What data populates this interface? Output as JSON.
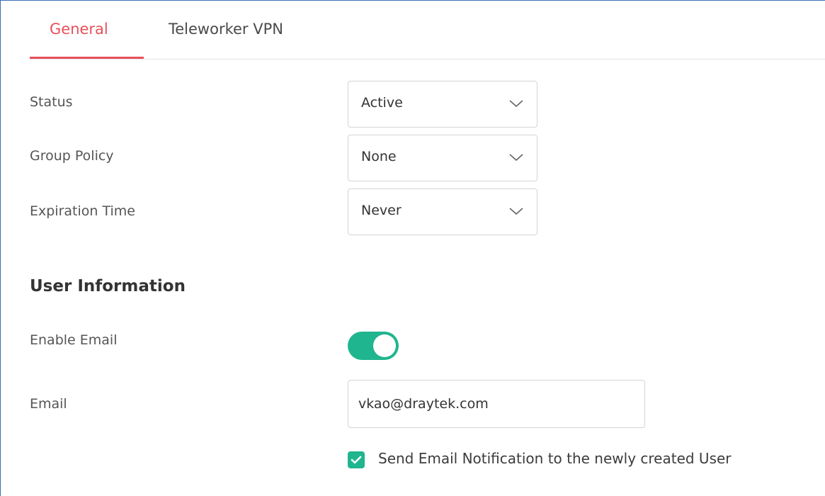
{
  "tabs": [
    {
      "label": "General",
      "active": true
    },
    {
      "label": "Teleworker VPN",
      "active": false
    }
  ],
  "form": {
    "status": {
      "label": "Status",
      "value": "Active"
    },
    "group_policy": {
      "label": "Group Policy",
      "value": "None"
    },
    "expiration_time": {
      "label": "Expiration Time",
      "value": "Never"
    }
  },
  "user_information": {
    "title": "User Information",
    "enable_email": {
      "label": "Enable Email",
      "enabled": true
    },
    "email": {
      "label": "Email",
      "value": "vkao@draytek.com"
    },
    "send_notification": {
      "label": "Send Email Notification to the newly created User",
      "checked": true
    }
  },
  "colors": {
    "accent_tab": "#e8505b",
    "toggle_on": "#1fb58f",
    "frame_border": "#3b6fb6"
  },
  "icons": {
    "select_arrow": "chevron-down-icon",
    "checkbox_mark": "checkmark-icon"
  }
}
